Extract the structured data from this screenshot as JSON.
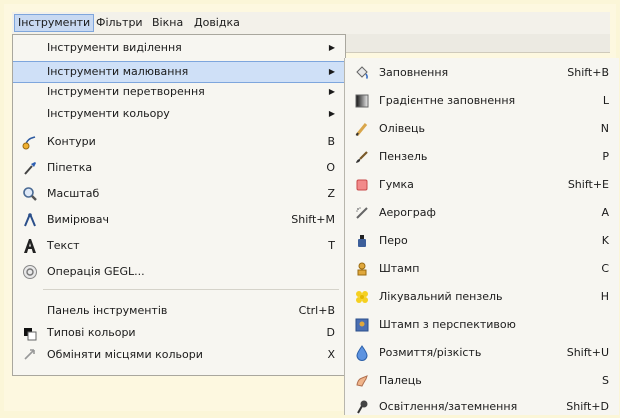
{
  "menubar": [
    "Інструменти",
    "Фільтри",
    "Вікна",
    "Довідка"
  ],
  "menu": [
    {
      "label": "Інструменти виділення",
      "arrow": "▶"
    },
    {
      "label": "Інструменти малювання",
      "arrow": "▶"
    },
    {
      "label": "Інструменти перетворення",
      "arrow": "▶"
    },
    {
      "label": "Інструменти кольору",
      "arrow": "▶"
    },
    {
      "label": "Контури",
      "shortcut": "B"
    },
    {
      "label": "Піпетка",
      "shortcut": "O"
    },
    {
      "label": "Масштаб",
      "shortcut": "Z"
    },
    {
      "label": "Вимірювач",
      "shortcut": "Shift+M"
    },
    {
      "label": "Текст",
      "shortcut": "T"
    },
    {
      "label": "Операція GEGL..."
    },
    {
      "label": "Панель інструментів",
      "shortcut": "Ctrl+B"
    },
    {
      "label": "Типові кольори",
      "shortcut": "D"
    },
    {
      "label": "Обміняти місцями кольори",
      "shortcut": "X"
    }
  ],
  "submenu": [
    {
      "label": "Заповнення",
      "shortcut": "Shift+B"
    },
    {
      "label": "Градієнтне заповнення",
      "shortcut": "L"
    },
    {
      "label": "Олівець",
      "shortcut": "N"
    },
    {
      "label": "Пензель",
      "shortcut": "P"
    },
    {
      "label": "Гумка",
      "shortcut": "Shift+E"
    },
    {
      "label": "Аерограф",
      "shortcut": "A"
    },
    {
      "label": "Перо",
      "shortcut": "K"
    },
    {
      "label": "Штамп",
      "shortcut": "C"
    },
    {
      "label": "Лікувальний пензель",
      "shortcut": "H"
    },
    {
      "label": "Штамп з перспективою",
      "shortcut": ""
    },
    {
      "label": "Розмиття/різкість",
      "shortcut": "Shift+U"
    },
    {
      "label": "Палець",
      "shortcut": "S"
    },
    {
      "label": "Освітлення/затемнення",
      "shortcut": "Shift+D"
    }
  ]
}
